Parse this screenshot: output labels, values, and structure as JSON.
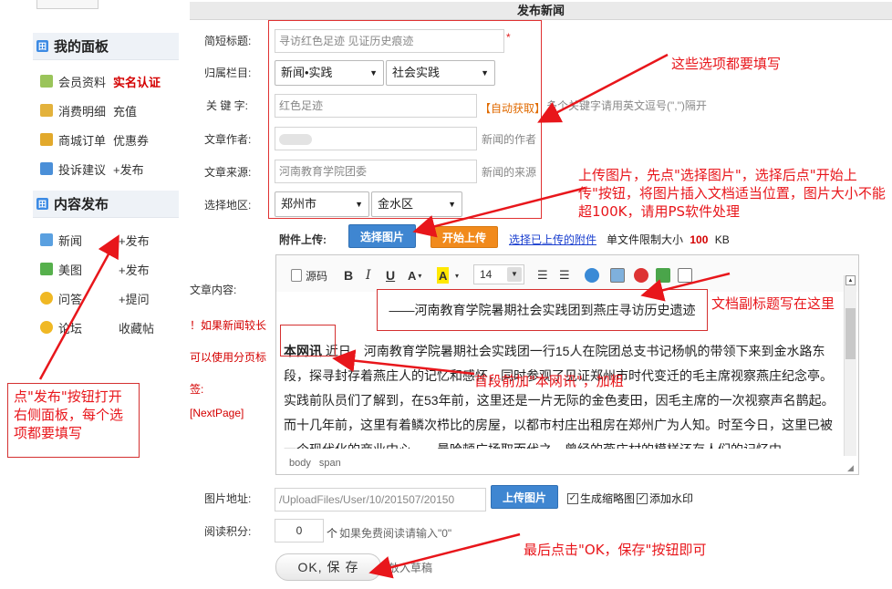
{
  "page_title": "发布新闻",
  "sidebar": {
    "sections": [
      {
        "title": "我的面板",
        "items": [
          {
            "label": "会员资料",
            "extra": "实名认证"
          },
          {
            "label": "消费明细",
            "extra": "充值"
          },
          {
            "label": "商城订单",
            "extra": "优惠券"
          },
          {
            "label": "投诉建议",
            "extra": "+发布"
          }
        ]
      },
      {
        "title": "内容发布",
        "items": [
          {
            "label": "新闻",
            "extra": "+发布"
          },
          {
            "label": "美图",
            "extra": "+发布"
          },
          {
            "label": "问答",
            "extra": "+提问"
          },
          {
            "label": "论坛",
            "extra": "收藏帖"
          }
        ]
      }
    ]
  },
  "form": {
    "short_title": {
      "label": "简短标题:",
      "value": "寻访红色足迹 见证历史痕迹",
      "required_mark": "*"
    },
    "column": {
      "label": "归属栏目:",
      "select1": "新闻•实践",
      "select2": "社会实践"
    },
    "keywords": {
      "label": "关 键 字:",
      "value": "红色足迹",
      "auto_button": "【自动获取】",
      "hint": "多个关键字请用英文逗号(\",\")隔开"
    },
    "author": {
      "label": "文章作者:",
      "value": "",
      "hint": "新闻的作者"
    },
    "source": {
      "label": "文章来源:",
      "value": "河南教育学院团委",
      "hint": "新闻的来源"
    },
    "region": {
      "label": "选择地区:",
      "select1": "郑州市",
      "select2": "金水区"
    },
    "attachment": {
      "label": "附件上传:",
      "select_button": "选择图片",
      "start_button": "开始上传",
      "uploaded_link": "选择已上传的附件",
      "limit_prefix": "单文件限制大小",
      "limit_value": "100",
      "limit_unit": "KB"
    },
    "content": {
      "label": "文章内容:",
      "note": "！如果新闻较长可以使用分页标签:",
      "next_page_tag": "[NextPage]"
    },
    "image_url": {
      "label": "图片地址:",
      "value": "/UploadFiles/User/10/201507/20150",
      "upload_button": "上传图片",
      "thumb_label": "生成缩略图",
      "thumb_checked": true,
      "watermark_label": "添加水印",
      "watermark_checked": true
    },
    "points": {
      "label": "阅读积分:",
      "value": "0",
      "unit": "个",
      "hint": "如果免费阅读请输入\"0\""
    },
    "ok_button": "OK, 保 存",
    "draft_label": "放入草稿"
  },
  "editor": {
    "source_label": "源码",
    "font_size": "14",
    "subtitle": "——河南教育学院暑期社会实践团到燕庄寻访历史遗迹",
    "para1_bold": "本网讯",
    "para1": "近日，河南教育学院暑期社会实践团一行15人在院团总支书记杨帆的带领下来到金水路东段，探寻封存着燕庄人的记忆和感怀，同时参观了见证郑州市时代变迁的毛主席视察燕庄纪念亭。",
    "para2": "实践前队员们了解到，在53年前，这里还是一片无际的金色麦田，因毛主席的一次视察声名鹊起。而十几年前，这里有着鳞次栉比的房屋，以都市村庄出租房在郑州广为人知。时至今日，这里已被一个现代化的商业中心——曼哈顿广场取而代之。曾经的燕庄村的模样还存人们的记忆中",
    "status": [
      "body",
      "span"
    ]
  },
  "annotations": {
    "fill_all": "这些选项都要填写",
    "upload_tip": "上传图片，先点\"选择图片\"，选择后点\"开始上传\"按钮，将图片插入文档适当位置，图片大小不能超100K，请用PS软件处理",
    "subtitle_tip": "文档副标题写在这里",
    "bold_tip": "首段前加\"本网讯\"，加粗",
    "publish_tip": "点\"发布\"按钮打开右侧面板，每个选项都要填写",
    "ok_tip": "最后点击\"OK，保存\"按钮即可"
  },
  "colors": {
    "accent_blue": "#3f86d1",
    "accent_orange": "#f18a1c",
    "annotation_red": "#e8161b",
    "required_red": "#d40000"
  }
}
